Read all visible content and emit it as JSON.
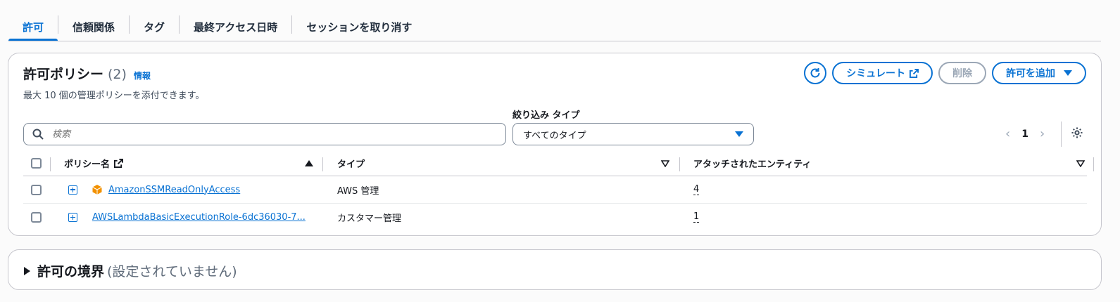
{
  "tabs": [
    {
      "label": "許可",
      "active": true
    },
    {
      "label": "信頼関係"
    },
    {
      "label": "タグ"
    },
    {
      "label": "最終アクセス日時"
    },
    {
      "label": "セッションを取り消す"
    }
  ],
  "permissions": {
    "title": "許可ポリシー",
    "count": "(2)",
    "info": "情報",
    "description": "最大 10 個の管理ポリシーを添付できます。",
    "buttons": {
      "refresh_icon": "refresh-icon",
      "simulate": "シミュレート",
      "delete": "削除",
      "add": "許可を追加"
    },
    "filter_label": "絞り込み タイプ",
    "search_placeholder": "検索",
    "filter_select": "すべてのタイプ",
    "page": "1",
    "columns": {
      "name": "ポリシー名",
      "type": "タイプ",
      "attached": "アタッチされたエンティティ"
    },
    "rows": [
      {
        "name": "AmazonSSMReadOnlyAccess",
        "type": "AWS 管理",
        "attached": "4",
        "aws_icon": true
      },
      {
        "name": "AWSLambdaBasicExecutionRole-6dc36030-7...",
        "type": "カスタマー管理",
        "attached": "1",
        "aws_icon": false
      }
    ]
  },
  "boundary": {
    "title": "許可の境界",
    "subtitle": "(設定されていません)"
  },
  "colors": {
    "accent": "#0972d3",
    "aws_orange": "#f29100"
  }
}
